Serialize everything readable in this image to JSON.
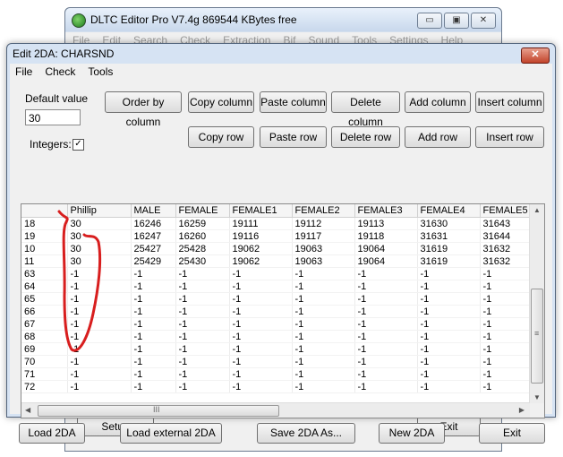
{
  "main_window": {
    "title": "DLTC Editor Pro V7.4g   869544 KBytes free",
    "menu": [
      "File",
      "Edit",
      "Search",
      "Check",
      "Extraction",
      "Bif",
      "Sound",
      "Tools",
      "Settings",
      "Help"
    ],
    "setup_button": "Setup",
    "exit_button": "Exit",
    "window_buttons": {
      "minimize": "▭",
      "maximize": "▣",
      "close": "✕"
    }
  },
  "dialog": {
    "title": "Edit 2DA: CHARSND",
    "close_glyph": "✕",
    "menu": [
      "File",
      "Check",
      "Tools"
    ],
    "default_value_label": "Default value",
    "default_value": "30",
    "integers_label": "Integers:",
    "integers_checked": true,
    "check_mark": "✓",
    "column_buttons": [
      "Order by column",
      "Copy column",
      "Paste column",
      "Delete column",
      "Add column",
      "Insert column"
    ],
    "row_buttons": [
      "Copy row",
      "Paste row",
      "Delete row",
      "Add row",
      "Insert row"
    ],
    "bottom_buttons": [
      "Load 2DA",
      "Load external 2DA",
      "Save 2DA As...",
      "New 2DA",
      "Exit"
    ],
    "scroll_thumb_grip": "≡",
    "hscroll_thumb_grip": "III",
    "arrows": {
      "up": "▲",
      "down": "▼",
      "left": "◀",
      "right": "▶"
    }
  },
  "table": {
    "columns": [
      "",
      "Phillip",
      "MALE",
      "FEMALE",
      "FEMALE1",
      "FEMALE2",
      "FEMALE3",
      "FEMALE4",
      "FEMALE5"
    ],
    "rows": [
      [
        "18",
        "30",
        "16246",
        "16259",
        "19111",
        "19112",
        "19113",
        "31630",
        "31643"
      ],
      [
        "19",
        "30",
        "16247",
        "16260",
        "19116",
        "19117",
        "19118",
        "31631",
        "31644"
      ],
      [
        "10",
        "30",
        "25427",
        "25428",
        "19062",
        "19063",
        "19064",
        "31619",
        "31632"
      ],
      [
        "11",
        "30",
        "25429",
        "25430",
        "19062",
        "19063",
        "19064",
        "31619",
        "31632"
      ],
      [
        "63",
        "-1",
        "-1",
        "-1",
        "-1",
        "-1",
        "-1",
        "-1",
        "-1"
      ],
      [
        "64",
        "-1",
        "-1",
        "-1",
        "-1",
        "-1",
        "-1",
        "-1",
        "-1"
      ],
      [
        "65",
        "-1",
        "-1",
        "-1",
        "-1",
        "-1",
        "-1",
        "-1",
        "-1"
      ],
      [
        "66",
        "-1",
        "-1",
        "-1",
        "-1",
        "-1",
        "-1",
        "-1",
        "-1"
      ],
      [
        "67",
        "-1",
        "-1",
        "-1",
        "-1",
        "-1",
        "-1",
        "-1",
        "-1"
      ],
      [
        "68",
        "-1",
        "-1",
        "-1",
        "-1",
        "-1",
        "-1",
        "-1",
        "-1"
      ],
      [
        "69",
        "-1",
        "-1",
        "-1",
        "-1",
        "-1",
        "-1",
        "-1",
        "-1"
      ],
      [
        "70",
        "-1",
        "-1",
        "-1",
        "-1",
        "-1",
        "-1",
        "-1",
        "-1"
      ],
      [
        "71",
        "-1",
        "-1",
        "-1",
        "-1",
        "-1",
        "-1",
        "-1",
        "-1"
      ],
      [
        "72",
        "-1",
        "-1",
        "-1",
        "-1",
        "-1",
        "-1",
        "-1",
        "-1"
      ]
    ]
  },
  "annotation": {
    "color": "#d81e1e"
  }
}
